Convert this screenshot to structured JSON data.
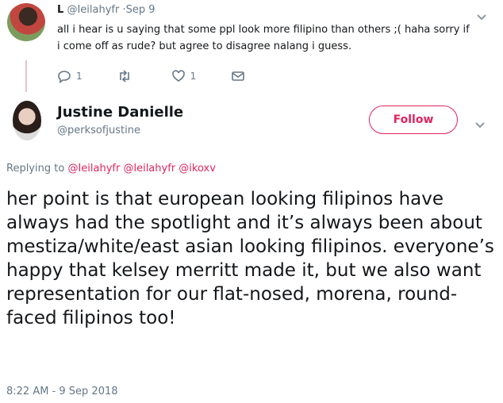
{
  "parent_tweet": {
    "name": "L",
    "handle": "@Ieilahyfr",
    "separator": "·",
    "date": "Sep 9",
    "text": "all i hear is u saying that some ppl look more filipino than others ;( haha sorry if i come off as rude? but agree to disagree nalang i guess.",
    "actions": {
      "reply_count": "1",
      "retweet_count": "",
      "like_count": "1"
    }
  },
  "main_tweet": {
    "name": "Justine Danielle",
    "handle": "@perksofjustine",
    "follow_label": "Follow",
    "replying_to_label": "Replying to",
    "mentions": [
      "@Ieilahyfr",
      "@leilahyfr",
      "@ikoxv"
    ],
    "text": "her point is that european looking filipinos have always had the spotlight and it’s always been about mestiza/white/east asian looking filipinos. everyone’s happy that kelsey merritt made it, but we also want representation for our flat-nosed, morena, round-faced filipinos too!",
    "timestamp": "8:22 AM - 9 Sep 2018"
  },
  "colors": {
    "accent": "#e0245e",
    "muted": "#657786",
    "text": "#14171a",
    "thread_line": "#e6c3c9"
  },
  "icons": [
    "reply-icon",
    "retweet-icon",
    "like-icon",
    "dm-icon",
    "chevron-down-icon"
  ]
}
